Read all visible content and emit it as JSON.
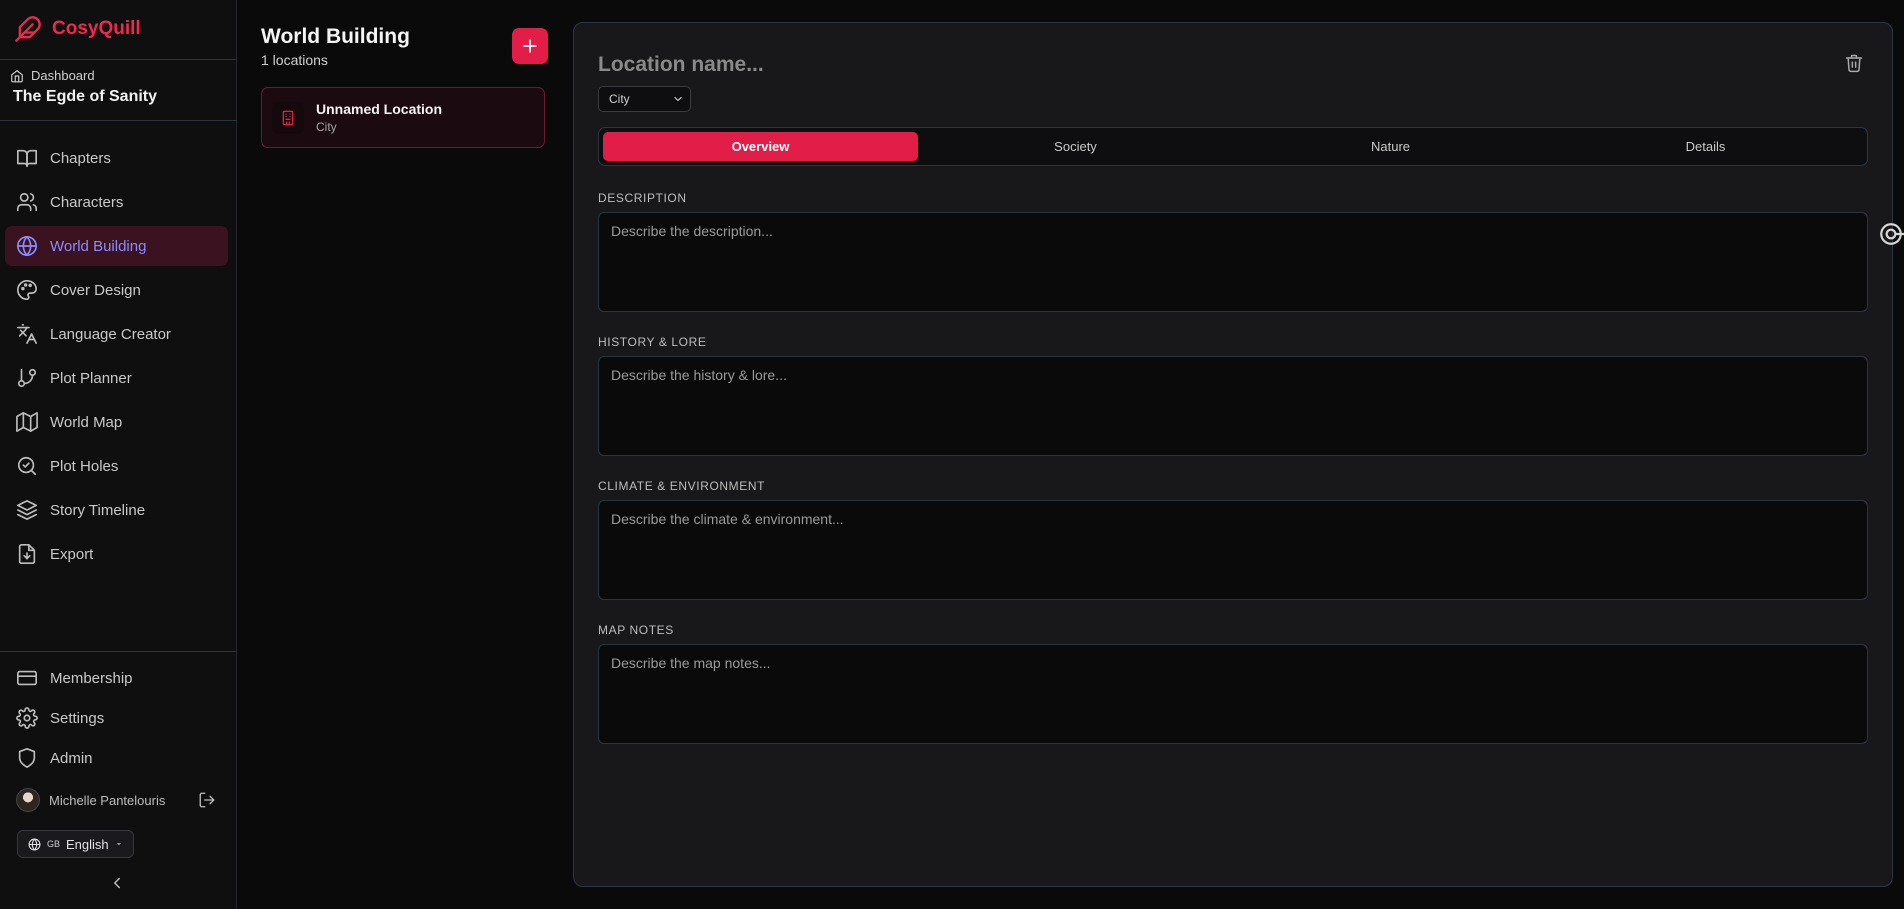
{
  "app": {
    "name": "CosyQuill"
  },
  "breadcrumb": {
    "dashboard_label": "Dashboard",
    "project_title": "The Egde of Sanity"
  },
  "sidebar": {
    "items": [
      {
        "label": "Chapters",
        "icon": "book-open-icon"
      },
      {
        "label": "Characters",
        "icon": "users-icon"
      },
      {
        "label": "World Building",
        "icon": "globe-icon",
        "active": true
      },
      {
        "label": "Cover Design",
        "icon": "palette-icon"
      },
      {
        "label": "Language Creator",
        "icon": "languages-icon"
      },
      {
        "label": "Plot Planner",
        "icon": "git-branch-icon"
      },
      {
        "label": "World Map",
        "icon": "map-icon"
      },
      {
        "label": "Plot Holes",
        "icon": "search-check-icon"
      },
      {
        "label": "Story Timeline",
        "icon": "layers-icon"
      },
      {
        "label": "Export",
        "icon": "file-export-icon"
      }
    ],
    "bottom_items": [
      {
        "label": "Membership",
        "icon": "credit-card-icon"
      },
      {
        "label": "Settings",
        "icon": "gear-icon"
      },
      {
        "label": "Admin",
        "icon": "shield-icon"
      }
    ],
    "user": {
      "name": "Michelle Pantelouris"
    },
    "language": {
      "flag": "GB",
      "label": "English"
    }
  },
  "locations": {
    "title": "World Building",
    "count_label": "1 locations",
    "items": [
      {
        "name": "Unnamed Location",
        "type": "City"
      }
    ]
  },
  "editor": {
    "name_placeholder": "Location name...",
    "type_selected": "City",
    "tabs": [
      {
        "label": "Overview",
        "active": true
      },
      {
        "label": "Society"
      },
      {
        "label": "Nature"
      },
      {
        "label": "Details"
      }
    ],
    "fields": [
      {
        "label": "DESCRIPTION",
        "placeholder": "Describe the description..."
      },
      {
        "label": "HISTORY & LORE",
        "placeholder": "Describe the history & lore..."
      },
      {
        "label": "CLIMATE & ENVIRONMENT",
        "placeholder": "Describe the climate & environment..."
      },
      {
        "label": "MAP NOTES",
        "placeholder": "Describe the map notes..."
      }
    ]
  },
  "colors": {
    "accent": "#e11d48",
    "active_text": "#8b8cff",
    "background": "#0a0a0b",
    "panel": "#18181a"
  }
}
